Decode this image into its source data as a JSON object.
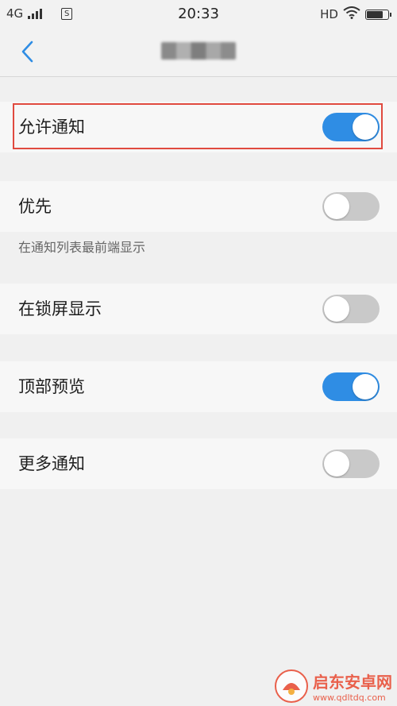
{
  "status_bar": {
    "network": "4G",
    "time": "20:33",
    "hd": "HD",
    "battery_level": 0.85,
    "icons": [
      "signal-icon",
      "sim-icon",
      "wifi-icon",
      "battery-icon"
    ]
  },
  "nav": {
    "back_icon": "chevron-left-icon",
    "title_redacted": true
  },
  "settings": [
    {
      "label": "允许通知",
      "on": true
    },
    {
      "label": "优先",
      "on": false
    },
    {
      "label": "在锁屏显示",
      "on": false
    },
    {
      "label": "顶部预览",
      "on": true
    },
    {
      "label": "更多通知",
      "on": false
    }
  ],
  "hints": {
    "priority": "在通知列表最前端显示"
  },
  "watermark": {
    "name": "启东安卓网",
    "url": "www.qdltdq.com"
  },
  "colors": {
    "accent": "#2f8de4",
    "toggle_off": "#c9c9c9",
    "highlight": "#e04a3f"
  }
}
